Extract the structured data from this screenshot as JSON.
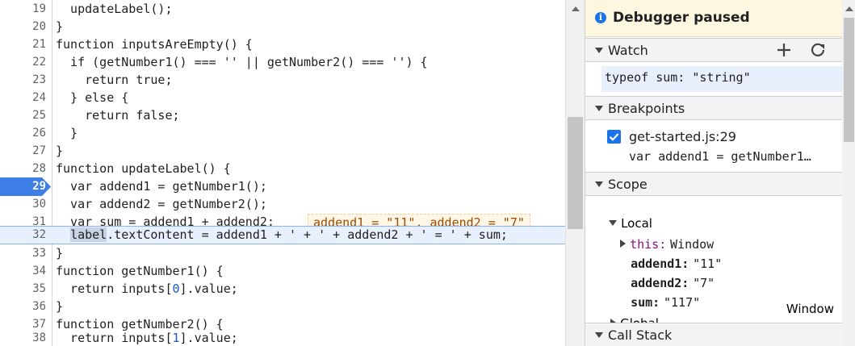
{
  "editor": {
    "lines": [
      {
        "n": "19",
        "code": "  updateLabel();"
      },
      {
        "n": "20",
        "code": "}"
      },
      {
        "n": "21",
        "code": "function inputsAreEmpty() {"
      },
      {
        "n": "22",
        "code": "  if (getNumber1() === '' || getNumber2() === '') {"
      },
      {
        "n": "23",
        "code": "    return true;"
      },
      {
        "n": "24",
        "code": "  } else {"
      },
      {
        "n": "25",
        "code": "    return false;"
      },
      {
        "n": "26",
        "code": "  }"
      },
      {
        "n": "27",
        "code": "}"
      },
      {
        "n": "28",
        "code": "function updateLabel() {"
      },
      {
        "n": "29",
        "code": "  var addend1 = getNumber1();"
      },
      {
        "n": "30",
        "code": "  var addend2 = getNumber2();"
      },
      {
        "n": "31",
        "code": "  var sum = addend1 + addend2;"
      },
      {
        "n": "32",
        "code": ""
      },
      {
        "n": "33",
        "code": "}"
      },
      {
        "n": "34",
        "code": "function getNumber1() {"
      },
      {
        "n": "35",
        "code": ""
      },
      {
        "n": "36",
        "code": "}"
      },
      {
        "n": "37",
        "code": "function getNumber2() {"
      },
      {
        "n": "38",
        "code": ""
      }
    ],
    "inline_values": "addend1 = \"11\", addend2 = \"7\"",
    "line32": {
      "indent": "  ",
      "selected": "label",
      "rest": ".textContent = addend1 + ' + ' + addend2 + ' = ' + sum;"
    },
    "line35": {
      "pre": "  return inputs[",
      "idx": "0",
      "post": "].value;"
    },
    "line38": {
      "pre": "  return inputs[",
      "idx": "1",
      "post": "].value;"
    }
  },
  "panel": {
    "paused_text": "Debugger paused",
    "watch": {
      "title": "Watch",
      "add_icon": "plus-icon",
      "refresh_icon": "refresh-icon",
      "expression": "typeof sum: \"string\""
    },
    "breakpoints": {
      "title": "Breakpoints",
      "file": "get-started.js:29",
      "code": "var addend1 = getNumber1…"
    },
    "scope": {
      "title": "Scope",
      "local_label": "Local",
      "this_label": "this:",
      "this_value": "Window",
      "vars": [
        {
          "name": "addend1:",
          "value": "\"11\""
        },
        {
          "name": "addend2:",
          "value": "\"7\""
        },
        {
          "name": "sum:",
          "value": "\"117\""
        }
      ],
      "global_label": "Global",
      "global_value": "Window"
    },
    "call_stack": {
      "title": "Call Stack"
    }
  },
  "colors": {
    "accent": "#1a73e8",
    "paused_bg": "#fef7e0",
    "current_line": "#e8f0fe",
    "inline_value_text": "#9c4a00"
  }
}
